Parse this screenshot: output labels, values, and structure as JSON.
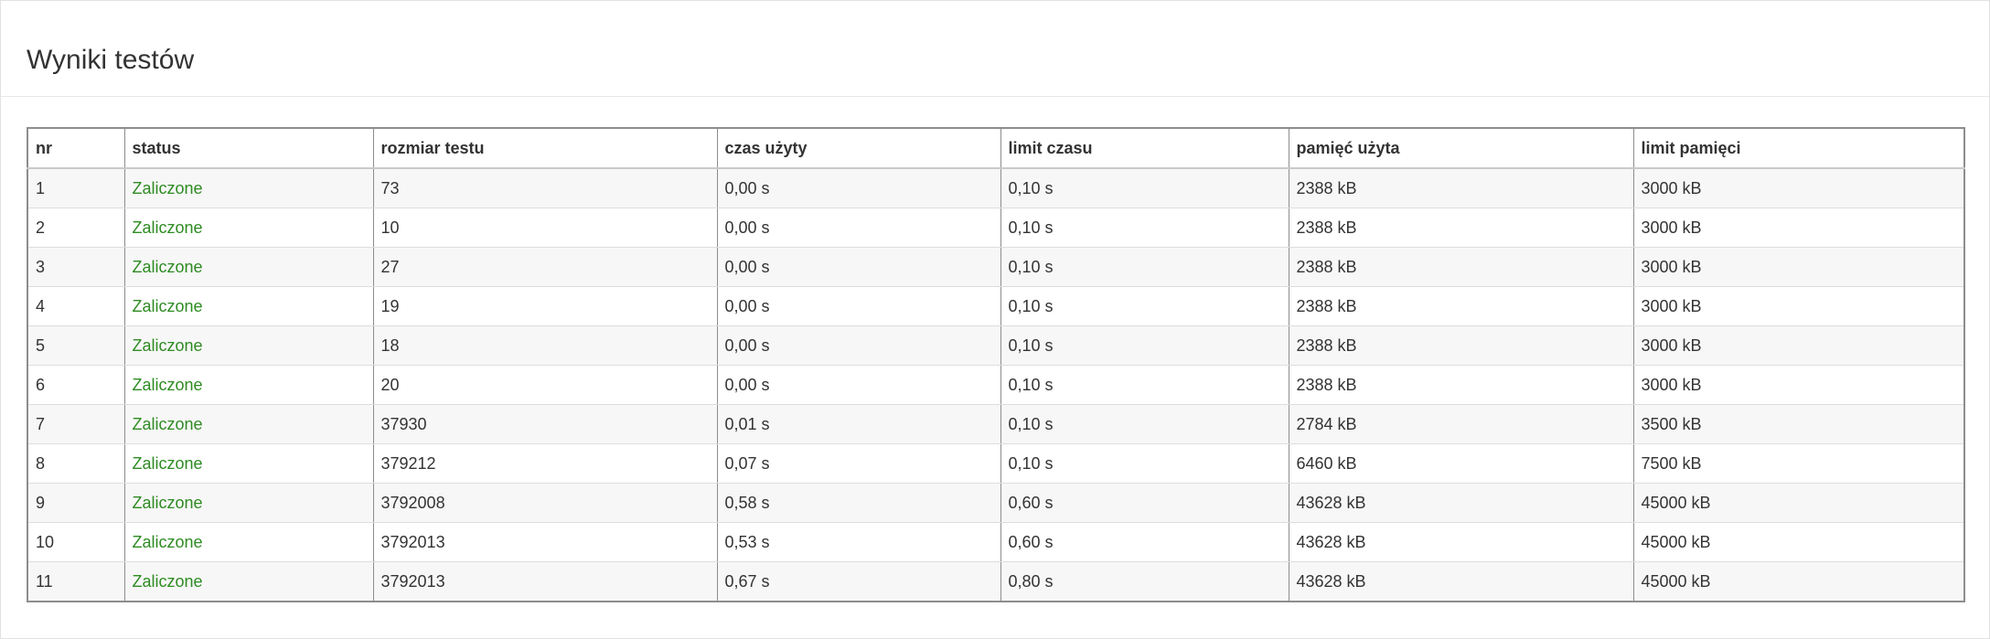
{
  "header": {
    "title": "Wyniki testów"
  },
  "colors": {
    "status_ok": "#2e8b22"
  },
  "table": {
    "columns": [
      "nr",
      "status",
      "rozmiar testu",
      "czas użyty",
      "limit czasu",
      "pamięć użyta",
      "limit pamięci"
    ],
    "rows": [
      [
        "1",
        "Zaliczone",
        "73",
        "0,00 s",
        "0,10 s",
        "2388 kB",
        "3000 kB"
      ],
      [
        "2",
        "Zaliczone",
        "10",
        "0,00 s",
        "0,10 s",
        "2388 kB",
        "3000 kB"
      ],
      [
        "3",
        "Zaliczone",
        "27",
        "0,00 s",
        "0,10 s",
        "2388 kB",
        "3000 kB"
      ],
      [
        "4",
        "Zaliczone",
        "19",
        "0,00 s",
        "0,10 s",
        "2388 kB",
        "3000 kB"
      ],
      [
        "5",
        "Zaliczone",
        "18",
        "0,00 s",
        "0,10 s",
        "2388 kB",
        "3000 kB"
      ],
      [
        "6",
        "Zaliczone",
        "20",
        "0,00 s",
        "0,10 s",
        "2388 kB",
        "3000 kB"
      ],
      [
        "7",
        "Zaliczone",
        "37930",
        "0,01 s",
        "0,10 s",
        "2784 kB",
        "3500 kB"
      ],
      [
        "8",
        "Zaliczone",
        "379212",
        "0,07 s",
        "0,10 s",
        "6460 kB",
        "7500 kB"
      ],
      [
        "9",
        "Zaliczone",
        "3792008",
        "0,58 s",
        "0,60 s",
        "43628 kB",
        "45000 kB"
      ],
      [
        "10",
        "Zaliczone",
        "3792013",
        "0,53 s",
        "0,60 s",
        "43628 kB",
        "45000 kB"
      ],
      [
        "11",
        "Zaliczone",
        "3792013",
        "0,67 s",
        "0,80 s",
        "43628 kB",
        "45000 kB"
      ]
    ]
  }
}
